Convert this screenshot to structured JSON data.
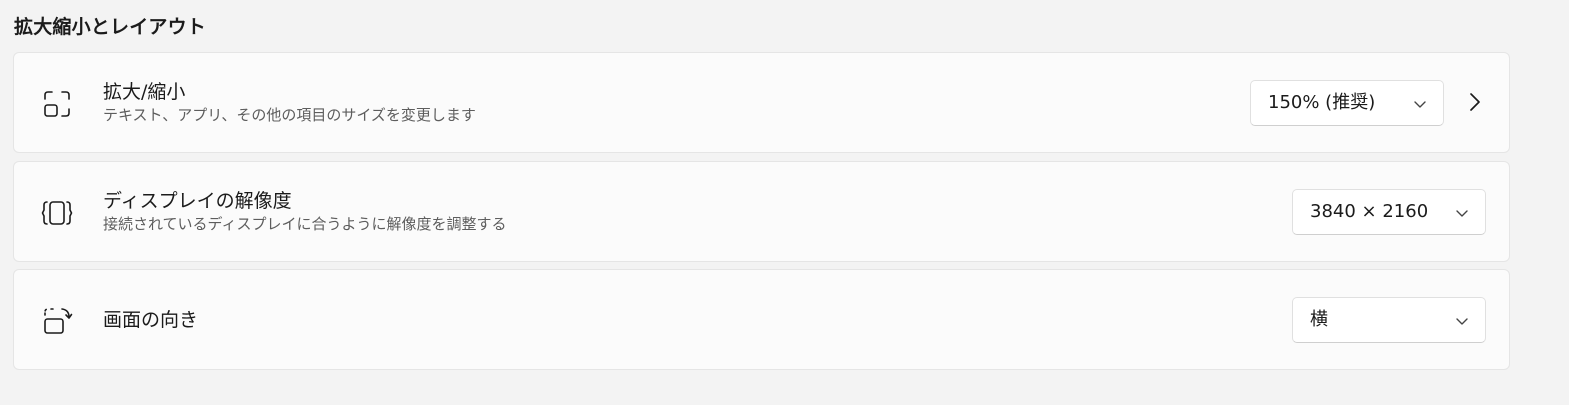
{
  "section": {
    "title": "拡大縮小とレイアウト"
  },
  "scale": {
    "title": "拡大/縮小",
    "description": "テキスト、アプリ、その他の項目のサイズを変更します",
    "value": "150% (推奨)",
    "icon": "scale-icon",
    "has_nav_arrow": true
  },
  "resolution": {
    "title": "ディスプレイの解像度",
    "description": "接続されているディスプレイに合うように解像度を調整する",
    "value": "3840 × 2160",
    "icon": "resolution-icon"
  },
  "orientation": {
    "title": "画面の向き",
    "value": "横",
    "icon": "orientation-icon"
  },
  "colors": {
    "background": "#f3f3f3",
    "card": "#fbfbfb",
    "text": "#1b1b1b",
    "secondary_text": "#5d5d5d"
  }
}
